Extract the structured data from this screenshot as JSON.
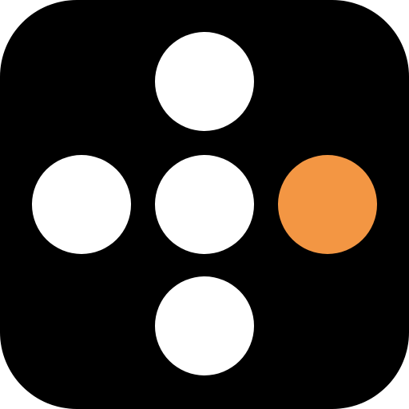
{
  "icon": {
    "background_color": "#000000",
    "dot_color": "#ffffff",
    "accent_color": "#f39643",
    "dots": [
      {
        "name": "top-dot",
        "color": "#ffffff"
      },
      {
        "name": "left-dot",
        "color": "#ffffff"
      },
      {
        "name": "center-dot",
        "color": "#ffffff"
      },
      {
        "name": "right-dot",
        "color": "#f39643"
      },
      {
        "name": "bottom-dot",
        "color": "#ffffff"
      }
    ]
  }
}
